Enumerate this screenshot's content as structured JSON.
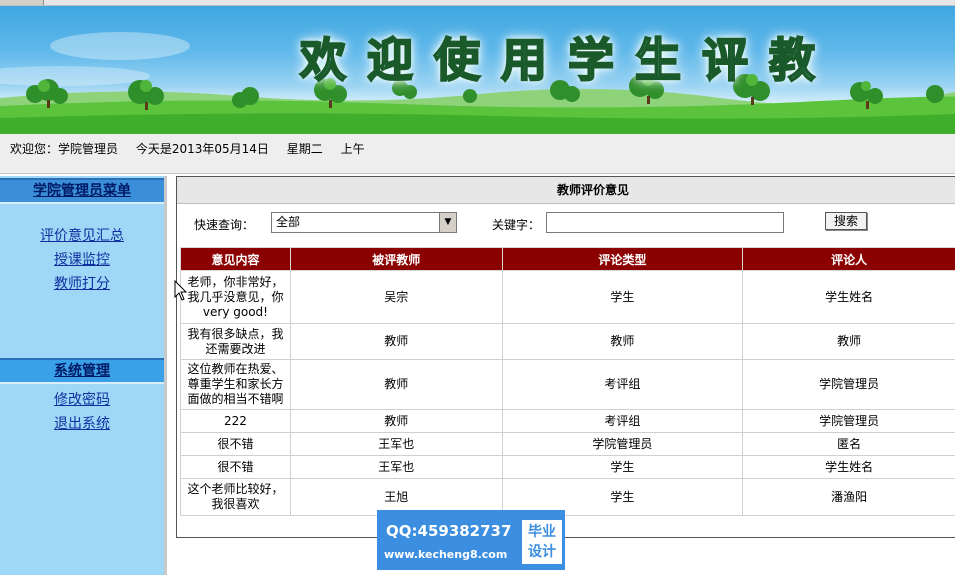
{
  "banner": {
    "title": "欢迎使用学生评教"
  },
  "status": {
    "welcome": "欢迎您：学院管理员",
    "date": "今天是2013年05月14日",
    "weekday": "星期二",
    "ampm": "上午"
  },
  "sidebar": {
    "section1": {
      "title": "学院管理员菜单",
      "items": [
        "评价意见汇总",
        "授课监控",
        "教师打分"
      ]
    },
    "section2": {
      "title": "系统管理",
      "items": [
        "修改密码",
        "退出系统"
      ]
    }
  },
  "main": {
    "title": "教师评价意见",
    "search": {
      "quick_label": "快速查询：",
      "quick_value": "全部",
      "keyword_label": "关键字：",
      "keyword_value": "",
      "button": "搜索"
    },
    "table": {
      "headers": [
        "意见内容",
        "被评教师",
        "评论类型",
        "评论人"
      ],
      "rows": [
        [
          "老师，你非常好，我几乎没意见，你very good!",
          "吴宗",
          "学生",
          "学生姓名"
        ],
        [
          "我有很多缺点，我还需要改进",
          "教师",
          "教师",
          "教师"
        ],
        [
          "这位教师在热爱、尊重学生和家长方面做的相当不错啊",
          "教师",
          "考评组",
          "学院管理员"
        ],
        [
          "222",
          "教师",
          "考评组",
          "学院管理员"
        ],
        [
          "很不错",
          "王军也",
          "学院管理员",
          "匿名"
        ],
        [
          "很不错",
          "王军也",
          "学生",
          "学生姓名"
        ],
        [
          "这个老师比较好，我很喜欢",
          "王旭",
          "学生",
          "潘渔阳"
        ]
      ]
    }
  },
  "watermark": {
    "qq": "QQ:459382737",
    "url": "www.kecheng8.com",
    "badge_line1": "毕业",
    "badge_line2": "设计"
  }
}
